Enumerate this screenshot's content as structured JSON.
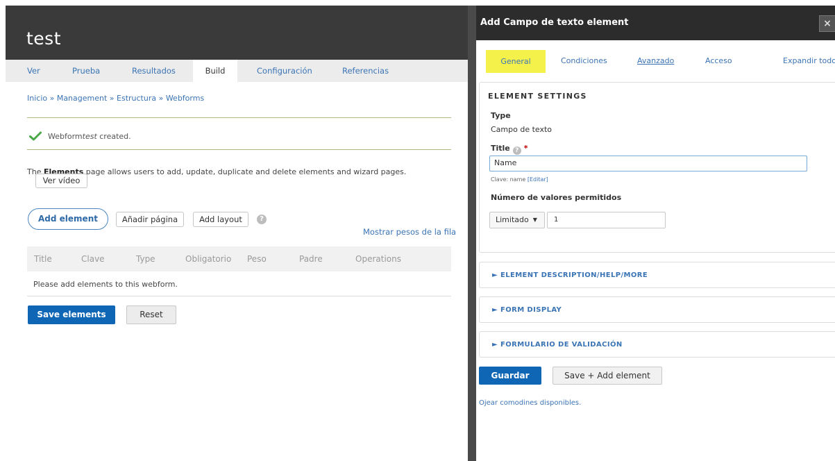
{
  "site": {
    "title": "test",
    "tabs": [
      "Ver",
      "Prueba",
      "Resultados",
      "Build",
      "Configuración",
      "Referencias"
    ],
    "active_tab": "Build"
  },
  "breadcrumb": "Inicio » Management » Estructura » Webforms",
  "status": {
    "prefix": "Webform ",
    "name": "test",
    "suffix": " created."
  },
  "intro": {
    "prefix": "The ",
    "bold": "Elements",
    "suffix": " page allows users to add, update, duplicate and delete elements and wizard pages."
  },
  "buttons": {
    "video": "Ver vídeo",
    "add_element": "Add element",
    "add_page": "Añadir página",
    "add_layout": "Add layout",
    "show_weights": "Mostrar pesos de la fila",
    "save_elements": "Save elements",
    "reset": "Reset"
  },
  "table": {
    "columns": [
      "Title",
      "Clave",
      "Type",
      "Obligatorio",
      "Peso",
      "Padre",
      "Operations"
    ],
    "empty_message": "Please add elements to this webform."
  },
  "dialog": {
    "title": "Add Campo de texto element",
    "close": "×",
    "tabs": [
      "General",
      "Condiciones",
      "Avanzado",
      "Acceso",
      "Expandir todo"
    ],
    "active_tab": "General",
    "settings_heading": "ELEMENT SETTINGS",
    "type_label": "Type",
    "type_value": "Campo de texto",
    "title_label": "Title",
    "title_value": "Name",
    "clave_prefix": "Clave: name ",
    "clave_edit": "[Editar]",
    "multiple_label": "Número de valores permitidos",
    "limit_option": "Limitado",
    "limit_value": "1",
    "sections": [
      "► ELEMENT DESCRIPTION/HELP/MORE",
      "► FORM DISPLAY",
      "► FORMULARIO DE VALIDACIÓN"
    ],
    "save": "Guardar",
    "save_add": "Save + Add element",
    "tokens_link": "Ojear comodines disponibles."
  },
  "colors": {
    "primary": "#0f66b5",
    "link": "#3b74b5",
    "header_dark": "#3a3a3a",
    "active_tab_highlight": "#f4f14a",
    "status_ok": "#4aa84a"
  }
}
